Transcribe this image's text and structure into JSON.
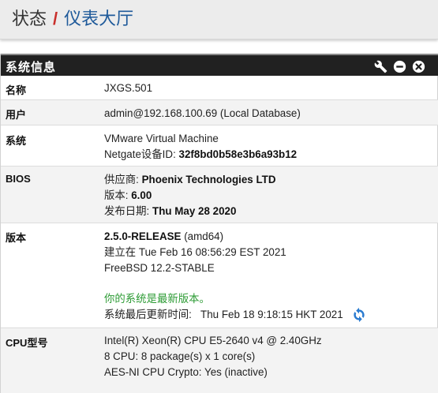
{
  "breadcrumb": {
    "section": "状态",
    "separator": "/",
    "page": "仪表大厅"
  },
  "panel": {
    "title": "系统信息",
    "tools": [
      "wrench-icon",
      "minus-circle-icon",
      "close-circle-icon"
    ]
  },
  "rows": {
    "name": {
      "label": "名称",
      "value": "JXGS.501"
    },
    "user": {
      "label": "用户",
      "value": "admin@192.168.100.69 (Local Database)"
    },
    "system": {
      "label": "系统",
      "line1": "VMware Virtual Machine",
      "netgate_prefix": "Netgate设备ID: ",
      "netgate_id": "32f8bd0b58e3b6a93b12"
    },
    "bios": {
      "label": "BIOS",
      "vendor_label": "供应商: ",
      "vendor": "Phoenix Technologies LTD",
      "version_label": "版本: ",
      "version": "6.00",
      "date_label": "发布日期: ",
      "date": "Thu May 28 2020"
    },
    "version": {
      "label": "版本",
      "release": "2.5.0-RELEASE",
      "arch": " (amd64)",
      "built": "建立在 Tue Feb 16 08:56:29 EST 2021",
      "freebsd": "FreeBSD 12.2-STABLE",
      "up_to_date": "你的系统是最新版本。",
      "last_check_label": "系统最后更新时间:",
      "last_check": "Thu Feb 18 9:18:15 HKT 2021"
    },
    "cpu": {
      "label": "CPU型号",
      "line1": "Intel(R) Xeon(R) CPU E5-2640 v4 @ 2.40GHz",
      "line2": "8 CPU: 8 package(s) x 1 core(s)",
      "line3": "AES-NI CPU Crypto: Yes (inactive)"
    }
  },
  "colors": {
    "heading_bg": "#212121",
    "link": "#1f5a9a",
    "separator": "#c9302c",
    "status_ok": "#2c9b34",
    "refresh": "#2a7bd0"
  }
}
